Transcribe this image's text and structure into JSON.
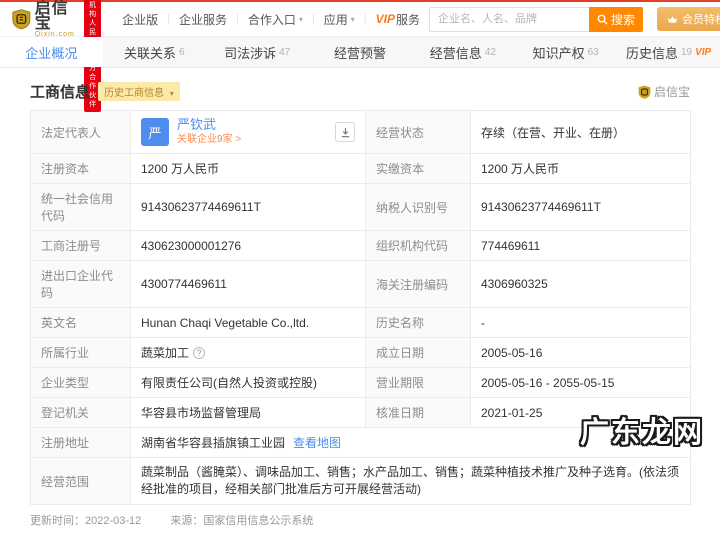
{
  "header": {
    "logo": {
      "title": "启信宝",
      "subtitle": "Qixin.com"
    },
    "badge_line1": "官方备案企业征信机构",
    "badge_line2": "人民数据官方合作伙伴",
    "nav": [
      {
        "label": "企业版"
      },
      {
        "label": "企业服务"
      },
      {
        "label": "合作入口"
      },
      {
        "label": "应用"
      }
    ],
    "vip_nav": {
      "prefix": "VIP",
      "suffix": "服务"
    },
    "search": {
      "placeholder": "企业名、人名、品牌",
      "button": "搜索"
    },
    "vip_button": "会员特权 >"
  },
  "tabs": [
    {
      "label": "企业概况",
      "count": ""
    },
    {
      "label": "关联关系",
      "count": "6"
    },
    {
      "label": "司法涉诉",
      "count": "47"
    },
    {
      "label": "经营预警",
      "count": ""
    },
    {
      "label": "经营信息",
      "count": "42"
    },
    {
      "label": "知识产权",
      "count": "63"
    },
    {
      "label": "历史信息",
      "count": "19",
      "vip_text": "VIP"
    }
  ],
  "section": {
    "title": "工商信息",
    "badge": "历史工商信息",
    "logo_text": "启信宝"
  },
  "table": {
    "legal_rep": {
      "label": "法定代表人",
      "avatar_char": "严",
      "name": "严钦武",
      "related": "关联企业9家 >",
      "status_label": "经营状态",
      "status_value": "存续（在营、开业、在册）"
    },
    "rows": [
      {
        "l1": "注册资本",
        "v1": "1200 万人民币",
        "l2": "实缴资本",
        "v2": "1200 万人民币"
      },
      {
        "l1": "统一社会信用代码",
        "v1": "91430623774469611T",
        "l2": "纳税人识别号",
        "v2": "91430623774469611T"
      },
      {
        "l1": "工商注册号",
        "v1": "430623000001276",
        "l2": "组织机构代码",
        "v2": "774469611"
      },
      {
        "l1": "进出口企业代码",
        "v1": "4300774469611",
        "l2": "海关注册编码",
        "v2": "4306960325"
      },
      {
        "l1": "英文名",
        "v1": "Hunan Chaqi Vegetable Co.,ltd.",
        "l2": "历史名称",
        "v2": "-"
      },
      {
        "l1": "所属行业",
        "v1": "蔬菜加工",
        "l2": "成立日期",
        "v2": "2005-05-16"
      },
      {
        "l1": "企业类型",
        "v1": "有限责任公司(自然人投资或控股)",
        "l2": "营业期限",
        "v2": "2005-05-16 - 2055-05-15"
      },
      {
        "l1": "登记机关",
        "v1": "华容县市场监督管理局",
        "l2": "核准日期",
        "v2": "2021-01-25"
      }
    ],
    "address": {
      "label": "注册地址",
      "value": "湖南省华容县插旗镇工业园",
      "map_link": "查看地图"
    },
    "scope": {
      "label": "经营范围",
      "value": "蔬菜制品（酱腌菜）、调味品加工、销售；水产品加工、销售；蔬菜种植技术推广及种子选育。(依法须经批准的项目，经相关部门批准后方可开展经营活动)"
    }
  },
  "footer": {
    "updated": "更新时间：2022-03-12",
    "source": "来源：国家信用信息公示系统"
  },
  "watermark": "广东龙网",
  "colors": {
    "accent_orange": "#ff8800",
    "brand_red": "#e60012",
    "link_blue": "#4e8cee",
    "related_orange": "#ff8a4c",
    "logo_gold": "#c9981f",
    "badge_yellow": "#fbe9a9"
  }
}
